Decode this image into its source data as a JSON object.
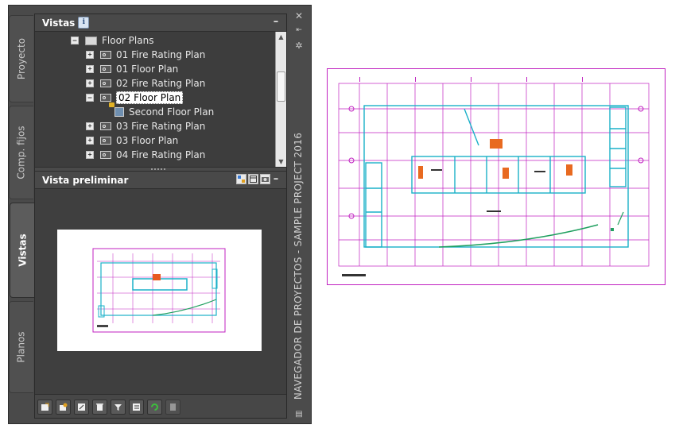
{
  "tabs": [
    {
      "label": "Proyecto"
    },
    {
      "label": "Comp. fijos"
    },
    {
      "label": "Vistas"
    },
    {
      "label": "Planos"
    }
  ],
  "views_section": {
    "title": "Vistas",
    "info_icon": "i",
    "collapse": "–"
  },
  "tree": {
    "root": "Floor Plans",
    "items": [
      {
        "label": "01 Fire Rating Plan",
        "expander": "+"
      },
      {
        "label": "01 Floor Plan",
        "expander": "+"
      },
      {
        "label": "02 Fire Rating Plan",
        "expander": "+"
      },
      {
        "label": "02 Floor Plan",
        "expander": "–",
        "selected": true
      },
      {
        "label": "Second Floor Plan",
        "child": true
      },
      {
        "label": "03 Fire Rating Plan",
        "expander": "+"
      },
      {
        "label": "03 Floor Plan",
        "expander": "+"
      },
      {
        "label": "04 Fire Rating Plan",
        "expander": "+"
      }
    ]
  },
  "preview_section": {
    "title": "Vista preliminar",
    "collapse": "–"
  },
  "palette": {
    "vertical_title": "NAVEGADOR DE PROYECTOS - SAMPLE PROJECT 2016",
    "close": "✕"
  },
  "toolbar": {
    "buttons": [
      "new-view",
      "add-view",
      "edit-view",
      "delete-view",
      "filter",
      "list-view",
      "refresh",
      "save"
    ]
  },
  "colors": {
    "drawing_magenta": "#c020c0",
    "drawing_cyan": "#1ab0c8",
    "drawing_green": "#20a060"
  }
}
